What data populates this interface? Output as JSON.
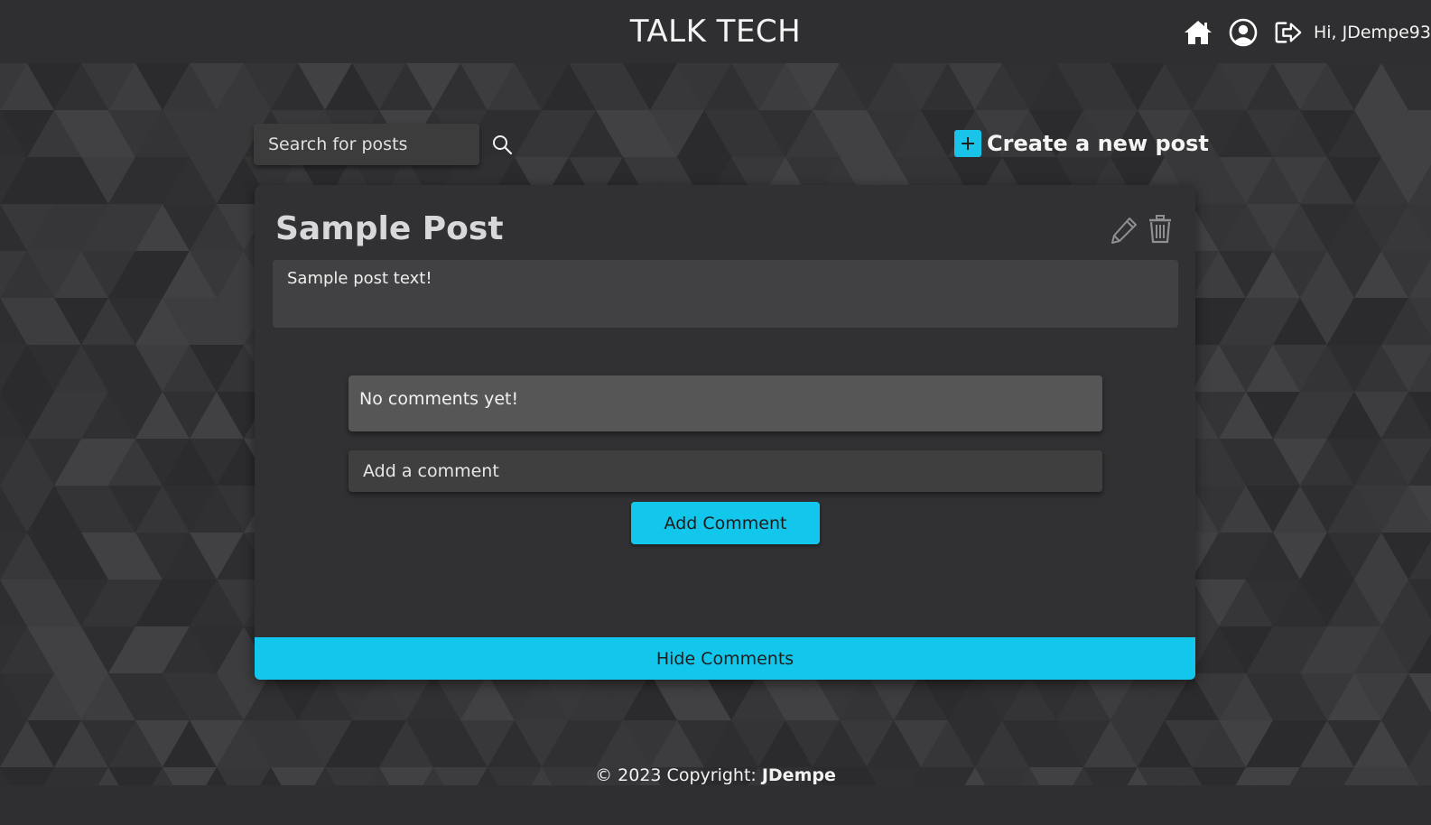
{
  "header": {
    "title": "TALK TECH",
    "greeting": "Hi, JDempe93",
    "icons": [
      "home-icon",
      "account-icon",
      "logout-icon"
    ]
  },
  "toolbar": {
    "search_placeholder": "Search for posts",
    "create_post_label": "Create a new post"
  },
  "post": {
    "title": "Sample Post",
    "body": "Sample post text!",
    "comments_empty": "No comments yet!",
    "comment_placeholder": "Add a comment",
    "add_comment_label": "Add Comment",
    "hide_comments_label": "Hide Comments"
  },
  "footer": {
    "prefix": "© 2023 Copyright: ",
    "author": "JDempe"
  },
  "colors": {
    "accent": "#13c7ec",
    "header_bg": "#2f2f31",
    "card_bg": "#313133"
  }
}
